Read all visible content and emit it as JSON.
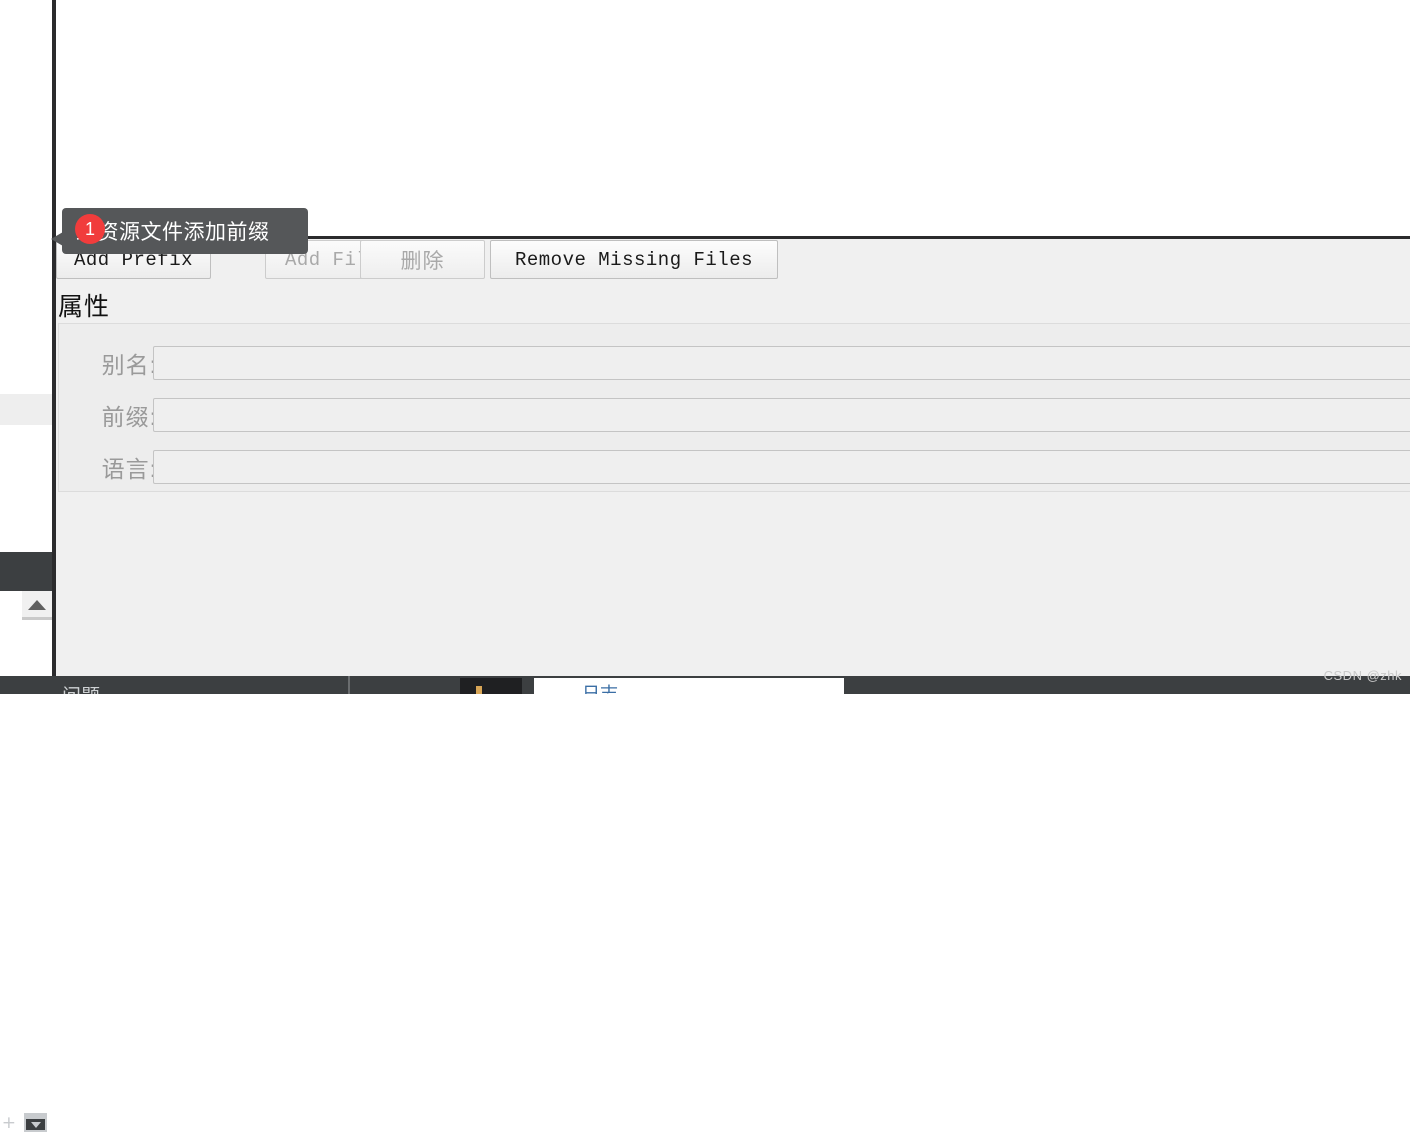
{
  "colors": {
    "badge_red": "#f13c3c",
    "tooltip_bg": "#555759",
    "panel_bg": "#f0f0f0",
    "group_bg": "#ededed",
    "divider_dark": "#2b2b2d",
    "ide_dark": "#3c3f41",
    "disabled_text": "#a9a9a9",
    "label_gray": "#9a9a9a"
  },
  "left_rail": {
    "plus_icon": "plus-icon",
    "panel_icon": "tool-window-icon",
    "scroll_up_icon": "scroll-up-arrow-icon"
  },
  "annotation": {
    "badge_number": "1",
    "tooltip_text": "给资源文件添加前缀"
  },
  "toolbar": {
    "buttons": [
      {
        "label": "Add Prefix",
        "name": "add-prefix-button",
        "disabled": false
      },
      {
        "label": "Add Files",
        "name": "add-files-button",
        "disabled": true
      },
      {
        "label": "删除",
        "name": "delete-button",
        "disabled": true
      },
      {
        "label": "Remove Missing Files",
        "name": "remove-missing-files-button",
        "disabled": false
      }
    ]
  },
  "properties": {
    "title": "属性",
    "fields": [
      {
        "label": "别名:",
        "value": "",
        "placeholder": "",
        "name": "alias"
      },
      {
        "label": "前缀:",
        "value": "",
        "placeholder": "",
        "name": "prefix"
      },
      {
        "label": "语言:",
        "value": "",
        "placeholder": "",
        "name": "language"
      }
    ]
  },
  "bottom_bar": {
    "left_label": "问题",
    "active_tab_label": "日志"
  },
  "watermark": {
    "text": "CSDN @zhk"
  }
}
